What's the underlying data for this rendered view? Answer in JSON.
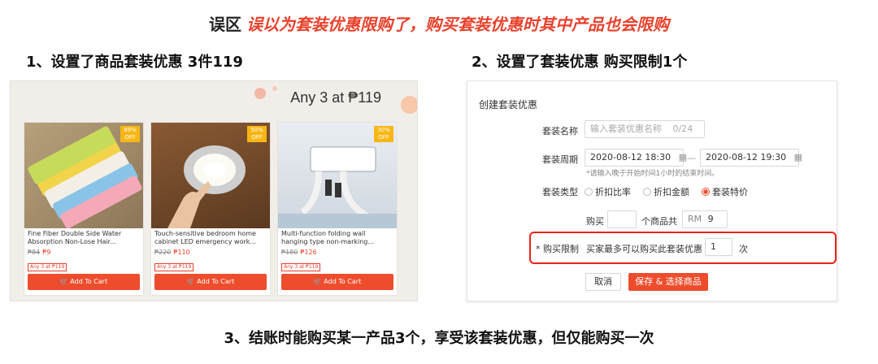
{
  "title": {
    "lead": "误区",
    "highlight": "误以为套装优惠限购了，购买套装优惠时其中产品也会限购"
  },
  "steps": {
    "step1": "1、设置了商品套装优惠 3件119",
    "step2": "2、设置了套装优惠 购买限制1个",
    "step3": "3、结账时能购买某一产品3个，享受该套装优惠，但仅能购买一次"
  },
  "shop": {
    "offer": "Any 3 at ₱119",
    "products": [
      {
        "badge": "89% OFF",
        "name": "Fine Fiber Double Side Water Absorption Non-Lose Hair...",
        "old_price": "₱84",
        "new_price": "₱9",
        "tag": "Any 3 at ₱119",
        "button": "Add To Cart"
      },
      {
        "badge": "50% OFF",
        "name": "Touch-sensitive bedroom home cabinet LED emergency work...",
        "old_price": "₱220",
        "new_price": "₱110",
        "tag": "Any 3 at ₱119",
        "button": "Add To Cart"
      },
      {
        "badge": "30% OFF",
        "name": "Multi-function folding wall hanging type non-marking...",
        "old_price": "₱180",
        "new_price": "₱126",
        "tag": "Any 3 at ₱119",
        "button": "Add To Cart"
      }
    ]
  },
  "form": {
    "title": "创建套装优惠",
    "name_label": "套装名称",
    "name_placeholder": "输入套装优惠名称",
    "name_count": "0/24",
    "period_label": "套装周期",
    "start": "2020-08-12 18:30",
    "dash": "—",
    "end": "2020-08-12 19:30",
    "period_hint": "*请输入晚于开始时间1小时的结束时间。",
    "type_label": "套装类型",
    "types": [
      "折扣比率",
      "折扣金额",
      "套装特价"
    ],
    "buy_label": "购买",
    "buy_mid": "个商品共",
    "currency": "RM",
    "price_value": "9",
    "limit_label": "* 购买限制",
    "limit_text": "买家最多可以购买此套装优惠",
    "limit_value": "1",
    "limit_unit": "次",
    "cancel": "取消",
    "save": "保存 & 选择商品"
  },
  "colors": {
    "accent": "#ee4d2d",
    "highlight": "#e8412b",
    "badge": "#f7b614",
    "redbox": "#e8231a"
  }
}
